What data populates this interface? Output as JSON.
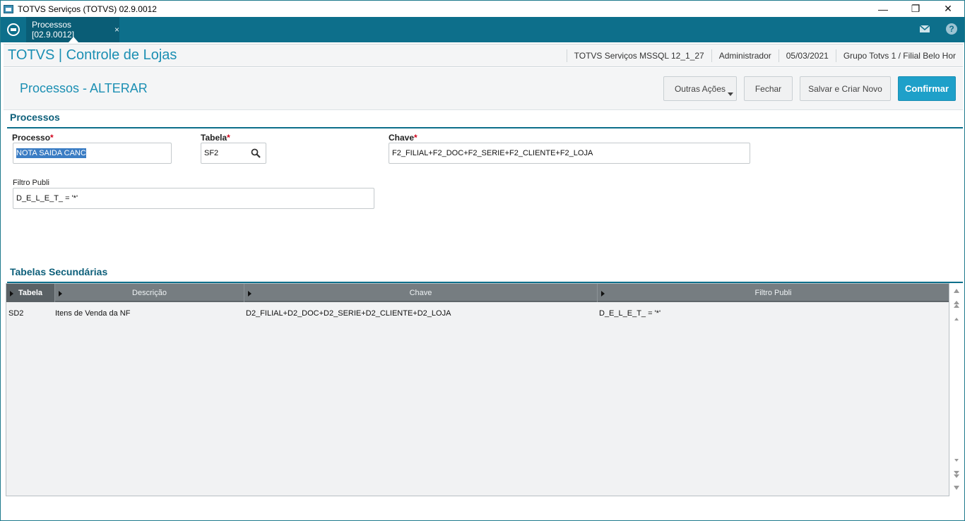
{
  "window": {
    "title": "TOTVS Serviços (TOTVS) 02.9.0012",
    "minimize": "—",
    "maximize": "❐",
    "close": "✕"
  },
  "tabbar": {
    "active_tab": "Processos [02.9.0012]",
    "tab_close": "×",
    "help": "?"
  },
  "header": {
    "brand": "TOTVS | Controle de Lojas",
    "environment": "TOTVS Serviços MSSQL 12_1_27",
    "user": "Administrador",
    "date": "05/03/2021",
    "branch": "Grupo Totvs 1 / Filial Belo Hor"
  },
  "actions": {
    "page_title": "Processos - ALTERAR",
    "outras_acoes": "Outras Ações",
    "fechar": "Fechar",
    "salvar_criar": "Salvar e Criar Novo",
    "confirmar": "Confirmar"
  },
  "form": {
    "section_title": "Processos",
    "processo_label": "Processo",
    "processo_value": "NOTA SAIDA CANC",
    "tabela_label": "Tabela",
    "tabela_value": "SF2",
    "chave_label": "Chave",
    "chave_value": "F2_FILIAL+F2_DOC+F2_SERIE+F2_CLIENTE+F2_LOJA",
    "filtro_label": "Filtro Publi",
    "filtro_value": "D_E_L_E_T_ = '*'",
    "required_mark": "*"
  },
  "secondary": {
    "section_title": "Tabelas Secundárias",
    "columns": [
      "Tabela",
      "Descrição",
      "Chave",
      "Filtro Publi"
    ],
    "rows": [
      {
        "tabela": "SD2",
        "descricao": "Itens de Venda da NF",
        "chave": "D2_FILIAL+D2_DOC+D2_SERIE+D2_CLIENTE+D2_LOJA",
        "filtro": "D_E_L_E_T_ = '*'"
      }
    ]
  },
  "colors": {
    "accent": "#1b8fb3",
    "tabbar": "#0d6f8b",
    "confirm": "#1ea0c9",
    "required": "#d0021b"
  }
}
